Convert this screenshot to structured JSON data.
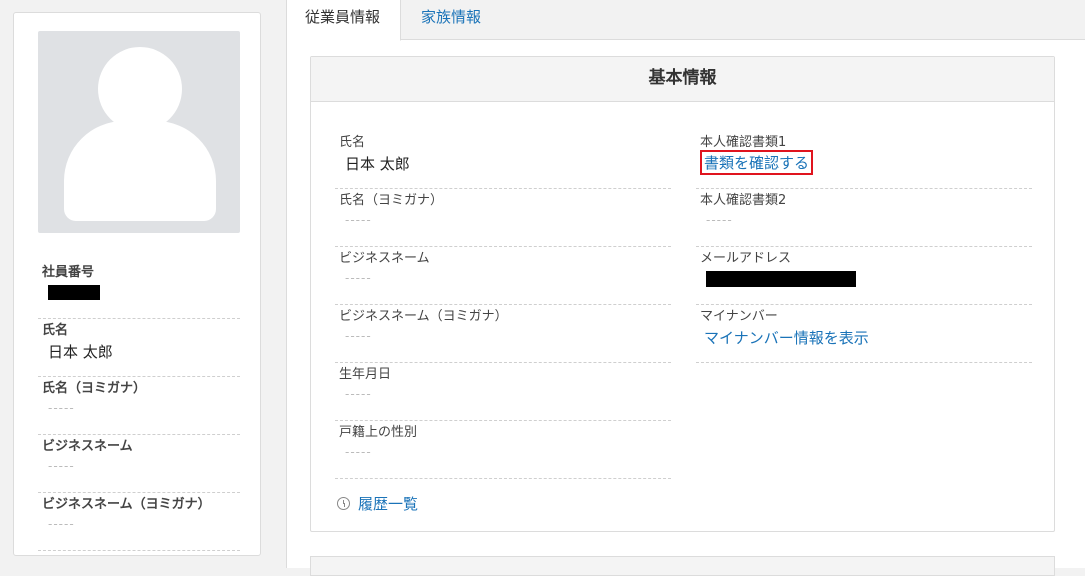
{
  "profile": {
    "fields": [
      {
        "label": "社員番号",
        "value": ""
      },
      {
        "label": "氏名",
        "value": "日本 太郎"
      },
      {
        "label": "氏名（ヨミガナ）",
        "value": "-----"
      },
      {
        "label": "ビジネスネーム",
        "value": "-----"
      },
      {
        "label": "ビジネスネーム（ヨミガナ）",
        "value": "-----"
      }
    ]
  },
  "tabs": [
    {
      "label": "従業員情報",
      "active": true
    },
    {
      "label": "家族情報",
      "active": false
    }
  ],
  "section": {
    "title": "基本情報",
    "left_fields": [
      {
        "label": "氏名",
        "value": "日本 太郎"
      },
      {
        "label": "氏名（ヨミガナ）",
        "value": "-----"
      },
      {
        "label": "ビジネスネーム",
        "value": "-----"
      },
      {
        "label": "ビジネスネーム（ヨミガナ）",
        "value": "-----"
      },
      {
        "label": "生年月日",
        "value": "-----"
      },
      {
        "label": "戸籍上の性別",
        "value": "-----"
      }
    ],
    "right_fields": [
      {
        "label": "本人確認書類1",
        "link": "書類を確認する"
      },
      {
        "label": "本人確認書類2",
        "value": "-----"
      },
      {
        "label": "メールアドレス",
        "value": ""
      },
      {
        "label": "マイナンバー",
        "link": "マイナンバー情報を表示"
      }
    ],
    "history_link": "履歴一覧"
  },
  "colors": {
    "link": "#1a73b8",
    "highlight_box": "#e0141e"
  }
}
